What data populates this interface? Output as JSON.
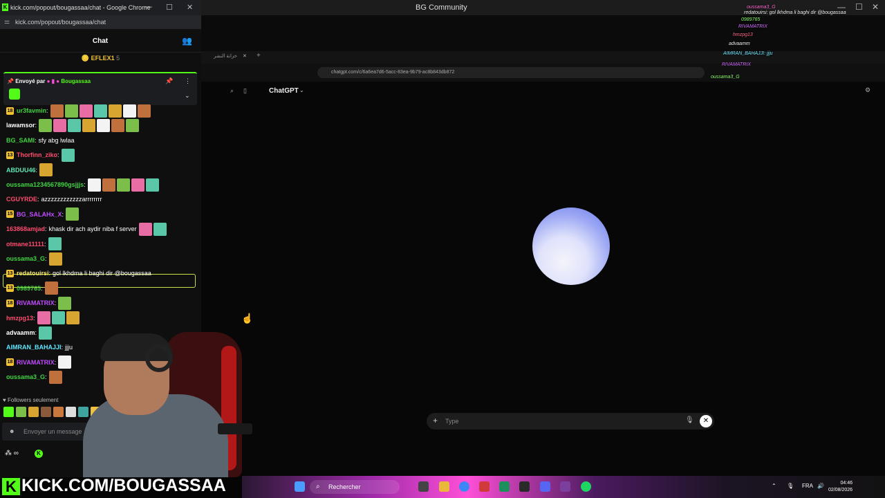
{
  "bg_window": {
    "title": "BG Community",
    "tab_label": "خزانة النشر",
    "url": "chatgpt.com/c/6a6ea7d6-5acc-83ea-9b79-ac8b843db872",
    "app_title": "ChatGPT",
    "input_placeholder": "Type",
    "cursor_glyph": "☝"
  },
  "overlay_chat": [
    {
      "user": "oussama3_G",
      "text": ""
    },
    {
      "user": "redatouirsi",
      "text": "gol lkhdma li baghi dir @bougassaa"
    },
    {
      "user": "0989765",
      "text": ""
    },
    {
      "user": "RIVAMATRIX",
      "text": ""
    },
    {
      "user": "hmzpg13",
      "text": ""
    },
    {
      "user": "advaamm",
      "text": ""
    },
    {
      "user": "AIMRAN_BAHAJJI",
      "text": "jjju"
    },
    {
      "user": "RIVAMATRIX",
      "text": ""
    },
    {
      "user": "oussama3_G",
      "text": ""
    }
  ],
  "chat_window": {
    "title": "kick.com/popout/bougassaa/chat - Google Chrome",
    "url": "kick.com/popout/bougassaa/chat",
    "header": "Chat",
    "gift_user": "EFLEX1",
    "gift_count": "5",
    "pinned_label": "Envoyé par",
    "pinned_user": "Bougassaa",
    "followers_label": "Followers seulement",
    "input_placeholder": "Envoyer un message",
    "infinity": "∞"
  },
  "messages": [
    {
      "badge": "18",
      "user": "ur3favmin",
      "color": "#3fd43f",
      "text": "",
      "emotes": 7
    },
    {
      "badge": "",
      "user": "lawamsor",
      "color": "#ffffff",
      "text": "",
      "emotes": 7
    },
    {
      "badge": "",
      "user": "BG_SAMI",
      "color": "#3fd43f",
      "text": "sfy abg lwlaa",
      "emotes": 0
    },
    {
      "badge": "13",
      "user": "Thorfinn_ziko",
      "color": "#ff4b6e",
      "text": "",
      "emotes": 1
    },
    {
      "badge": "",
      "user": "ABDUU46",
      "color": "#5ee8b3",
      "text": "",
      "emotes": 1
    },
    {
      "badge": "",
      "user": "oussama1234567890gsjjjs",
      "color": "#3fd43f",
      "text": "",
      "emotes": 5
    },
    {
      "badge": "",
      "user": "CGUYRDE",
      "color": "#ff4b6e",
      "text": "azzzzzzzzzzzzarrrrrrrr",
      "emotes": 0
    },
    {
      "badge": "15",
      "user": "BG_SALAHx_X",
      "color": "#c04bff",
      "text": "",
      "emotes": 1
    },
    {
      "badge": "",
      "user": "163868amjad",
      "color": "#ff4b6e",
      "text": "khask dir ach aydir niba f server",
      "emotes": 2
    },
    {
      "badge": "",
      "user": "otmane11111",
      "color": "#ff4b6e",
      "text": "",
      "emotes": 1
    },
    {
      "badge": "",
      "user": "oussama3_G",
      "color": "#3fd43f",
      "text": "",
      "emotes": 1
    },
    {
      "badge": "13",
      "user": "redatouirsi",
      "color": "#f1e36b",
      "text": "gol lkhdma li baghi dir @bougassaa",
      "emotes": 0
    },
    {
      "badge": "13",
      "user": "0989765",
      "color": "#3fd43f",
      "text": "",
      "emotes": 1
    },
    {
      "badge": "18",
      "user": "RIVAMATRIX",
      "color": "#c04bff",
      "text": "",
      "emotes": 1
    },
    {
      "badge": "",
      "user": "hmzpg13",
      "color": "#ff4b6e",
      "text": "",
      "emotes": 3
    },
    {
      "badge": "",
      "user": "advaamm",
      "color": "#ffffff",
      "text": "",
      "emotes": 1
    },
    {
      "badge": "",
      "user": "AIMRAN_BAHAJJI",
      "color": "#5ee8ff",
      "text": "jjju",
      "emotes": 0
    },
    {
      "badge": "18",
      "user": "RIVAMATRIX",
      "color": "#c04bff",
      "text": "",
      "emotes": 1
    },
    {
      "badge": "",
      "user": "oussama3_G",
      "color": "#3fd43f",
      "text": "",
      "emotes": 1
    }
  ],
  "banner": {
    "k": "K",
    "text": "KICK.COM/BOUGASSAA"
  },
  "taskbar": {
    "search_label": "Rechercher",
    "language": "FRA",
    "time": "04:46",
    "date": "02/08/2026"
  },
  "colors": {
    "kick_green": "#53fc18",
    "accent_yellow": "#f1c232"
  }
}
